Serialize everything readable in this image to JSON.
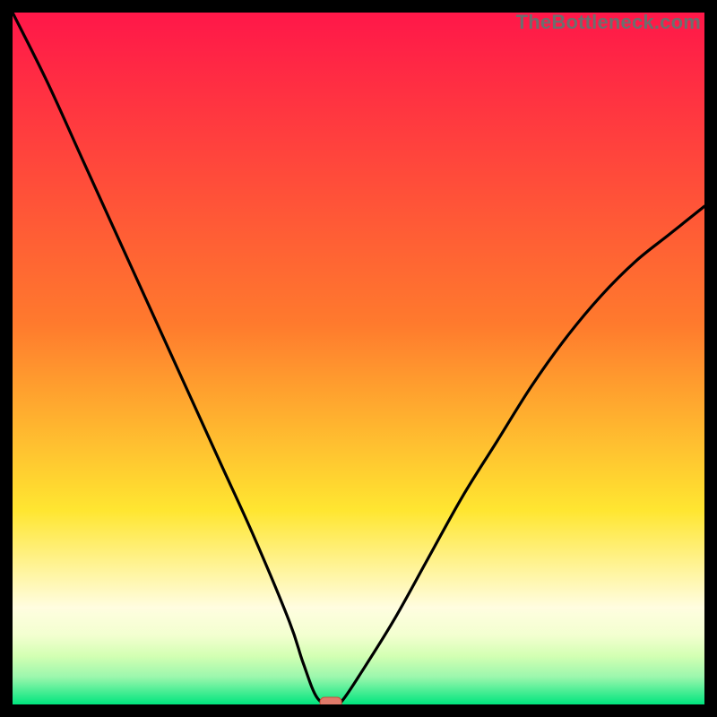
{
  "watermark": "TheBottleneck.com",
  "colors": {
    "frame": "#000000",
    "curve": "#000000",
    "marker_fill": "#e07a6a",
    "marker_stroke": "#c7503d",
    "grad_top": "#ff1749",
    "grad_mid1": "#ff7a2d",
    "grad_mid2": "#ffe631",
    "grad_band1": "#fffde0",
    "grad_band2": "#f3ffd0",
    "grad_band3": "#d3ffb3",
    "grad_band4": "#9cf7ad",
    "grad_bottom": "#00e57e"
  },
  "chart_data": {
    "type": "line",
    "title": "",
    "xlabel": "",
    "ylabel": "",
    "xlim": [
      0,
      100
    ],
    "ylim": [
      0,
      100
    ],
    "series": [
      {
        "name": "bottleneck-curve",
        "x": [
          0,
          5,
          10,
          15,
          20,
          25,
          30,
          35,
          40,
          42,
          44,
          46,
          47,
          48,
          50,
          55,
          60,
          65,
          70,
          75,
          80,
          85,
          90,
          95,
          100
        ],
        "values": [
          100,
          90,
          79,
          68,
          57,
          46,
          35,
          24,
          12,
          6,
          1,
          0,
          0,
          1,
          4,
          12,
          21,
          30,
          38,
          46,
          53,
          59,
          64,
          68,
          72
        ]
      }
    ],
    "marker": {
      "x": 46,
      "y": 0,
      "label": "optimal-point"
    },
    "gradient_stops": [
      {
        "pct": 0,
        "y_value": 100
      },
      {
        "pct": 45,
        "y_value": 55
      },
      {
        "pct": 72,
        "y_value": 28
      },
      {
        "pct": 86,
        "y_value": 14
      },
      {
        "pct": 90,
        "y_value": 10
      },
      {
        "pct": 93,
        "y_value": 7
      },
      {
        "pct": 96,
        "y_value": 4
      },
      {
        "pct": 100,
        "y_value": 0
      }
    ]
  }
}
